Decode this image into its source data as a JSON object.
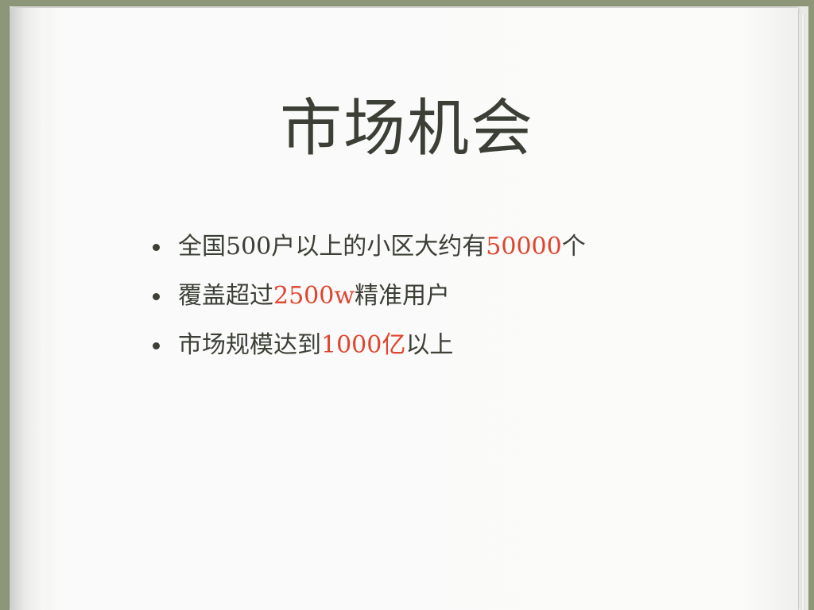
{
  "slide": {
    "title": "市场机会",
    "bullets": [
      {
        "pre": "全国500户以上的小区大约有",
        "highlight": "50000",
        "post": "个"
      },
      {
        "pre": "覆盖超过",
        "highlight": "2500w",
        "post": "精准用户"
      },
      {
        "pre": "市场规模达到",
        "highlight": "1000亿",
        "post": "以上"
      }
    ]
  },
  "colors": {
    "text": "#3b3f35",
    "highlight": "#e0442e",
    "cover": "#8d9679",
    "page": "#fafafa"
  }
}
